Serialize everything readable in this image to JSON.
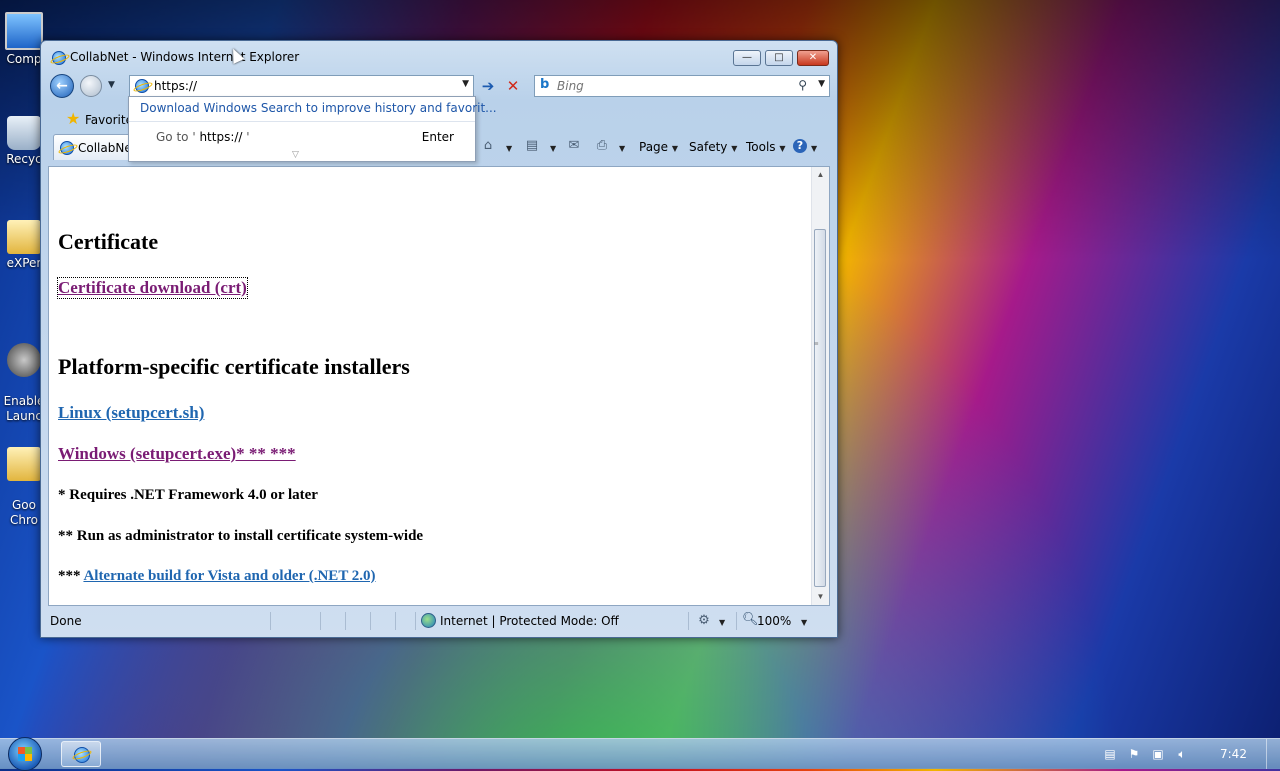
{
  "desktop": {
    "icons": [
      {
        "label": "Comp",
        "icon": "computer-icon"
      },
      {
        "label": "Recyc",
        "icon": "recycle-bin-icon"
      },
      {
        "label": "eXPer",
        "icon": "folder-icon"
      },
      {
        "label": "Enable\nLaunc",
        "icon": "launcher-icon"
      },
      {
        "label": "Goo\nChro",
        "icon": "folder-icon"
      }
    ]
  },
  "window": {
    "title": "CollabNet - Windows Internet Explorer",
    "controls": {
      "minimize": "—",
      "maximize": "□",
      "close": "✕"
    }
  },
  "nav": {
    "address_value": "https://",
    "search_placeholder": "Bing",
    "go_symbol": "➔",
    "stop_symbol": "✕"
  },
  "autocomplete": {
    "suggestion": "Download Windows Search to improve history and favorit...",
    "goto_prefix": "Go to '",
    "goto_url": " https:// ",
    "goto_suffix": "'",
    "enter_label": "Enter"
  },
  "favorites": {
    "label": "Favorite"
  },
  "tab": {
    "label": "CollabNet"
  },
  "commands": {
    "page": "Page",
    "safety": "Safety",
    "tools": "Tools"
  },
  "content": {
    "heading_certificate": "Certificate",
    "link_cert_download": "Certificate download (crt)",
    "heading_platform": "Platform-specific certificate installers",
    "link_linux": "Linux (setupcert.sh)",
    "link_windows": "Windows (setupcert.exe)* ** ***",
    "note_1": "* Requires .NET Framework 4.0 or later",
    "note_2": "** Run as administrator to install certificate system-wide",
    "note_3_prefix": "*** ",
    "link_alternate": "Alternate build for Vista and older (.NET 2.0)"
  },
  "status": {
    "text": "Done",
    "zone": "Internet | Protected Mode: Off",
    "zoom": "100%"
  },
  "taskbar": {
    "clock": "7:42"
  },
  "colors": {
    "visited_link": "#7a1c74",
    "link": "#1f66b0",
    "suggestion_link": "#1e56a8"
  }
}
